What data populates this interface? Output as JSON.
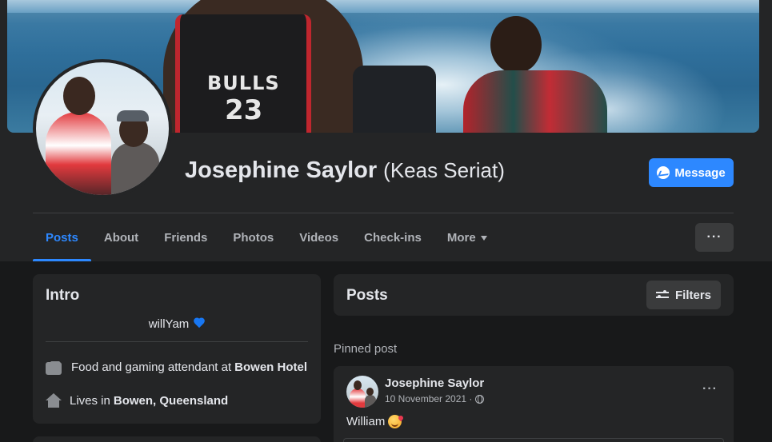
{
  "profile": {
    "name": "Josephine Saylor",
    "alternate_name": "(Keas Seriat)",
    "message_label": "Message"
  },
  "tabs": [
    {
      "label": "Posts",
      "active": true
    },
    {
      "label": "About"
    },
    {
      "label": "Friends"
    },
    {
      "label": "Photos"
    },
    {
      "label": "Videos"
    },
    {
      "label": "Check-ins"
    },
    {
      "label": "More"
    }
  ],
  "more_options_label": "···",
  "intro": {
    "title": "Intro",
    "bio": "willYam",
    "work": {
      "prefix": "Food and gaming attendant at",
      "place": "Bowen Hotel"
    },
    "lives": {
      "prefix": "Lives in",
      "place": "Bowen, Queensland"
    }
  },
  "posts_section": {
    "title": "Posts",
    "filters_label": "Filters",
    "pinned_label": "Pinned post"
  },
  "post": {
    "author": "Josephine Saylor",
    "date": "10 November 2021 ·",
    "text": "William",
    "more_label": "···"
  },
  "cover": {
    "jersey_text": "BULLS",
    "jersey_number": "23"
  },
  "colors": {
    "accent": "#2d88ff",
    "background": "#18191a",
    "card": "#242526"
  },
  "icons": [
    "messenger-icon",
    "caret-down-icon",
    "heart-icon",
    "briefcase-icon",
    "home-icon",
    "filter-icon",
    "globe-icon",
    "smiling-face-with-hearts-emoji"
  ]
}
